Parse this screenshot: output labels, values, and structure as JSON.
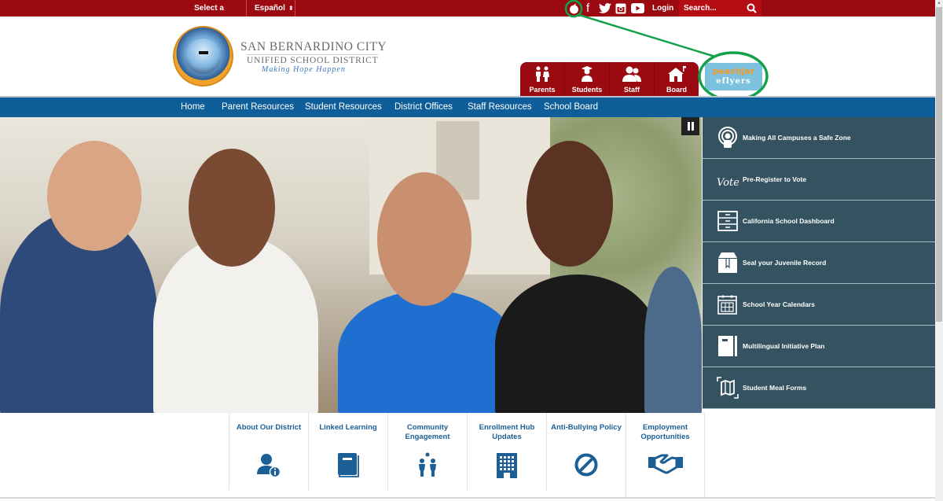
{
  "topbar": {
    "select_school": "Select a School",
    "language": "Español",
    "login": "Login",
    "search_placeholder": "Search...",
    "social": [
      "peachjar-icon",
      "facebook-icon",
      "twitter-icon",
      "instagram-icon",
      "youtube-icon"
    ]
  },
  "header": {
    "logo_line1": "SAN BERNARDINO CITY",
    "logo_line2": "UNIFIED SCHOOL DISTRICT",
    "logo_tagline": "Making Hope Happen",
    "audience_tabs": [
      {
        "label": "Parents",
        "icon": "parents-icon"
      },
      {
        "label": "Students",
        "icon": "student-graduate-icon"
      },
      {
        "label": "Staff",
        "icon": "staff-users-icon"
      },
      {
        "label": "Board",
        "icon": "schoolhouse-icon"
      }
    ],
    "peachjar": {
      "line1": "peachjar",
      "line2": "eflyers"
    }
  },
  "nav": {
    "items": [
      "Home",
      "Parent Resources",
      "Student Resources",
      "District Offices",
      "Staff Resources",
      "School Board"
    ]
  },
  "hero": {
    "pause_label": "Pause slideshow"
  },
  "quick_links": [
    {
      "label": "Making All Campuses a Safe Zone",
      "icon": "safe-zone-icon"
    },
    {
      "label": "Pre-Register to Vote",
      "icon": "vote-icon"
    },
    {
      "label": "California School Dashboard",
      "icon": "filing-cabinet-icon"
    },
    {
      "label": "Seal your Juvenile Record",
      "icon": "sealed-box-icon"
    },
    {
      "label": "School Year Calendars",
      "icon": "calendar-icon"
    },
    {
      "label": "Multilingual Initiative Plan",
      "icon": "notebook-icon"
    },
    {
      "label": "Student Meal Forms",
      "icon": "map-icon"
    }
  ],
  "tiles": [
    {
      "label": "About Our District",
      "icon": "user-info-icon"
    },
    {
      "label": "Linked Learning",
      "icon": "book-icon"
    },
    {
      "label": "Community Engagement",
      "icon": "community-icon"
    },
    {
      "label": "Enrollment Hub Updates",
      "icon": "building-icon"
    },
    {
      "label": "Anti-Bullying Policy",
      "icon": "ban-icon"
    },
    {
      "label": "Employment Opportunities",
      "icon": "handshake-icon"
    }
  ],
  "colors": {
    "topbar": "#9b0a10",
    "nav": "#0e5e9a",
    "quick_links_bg": "#34525f",
    "tile_text": "#1b5f96",
    "annotation": "#14a14a"
  }
}
